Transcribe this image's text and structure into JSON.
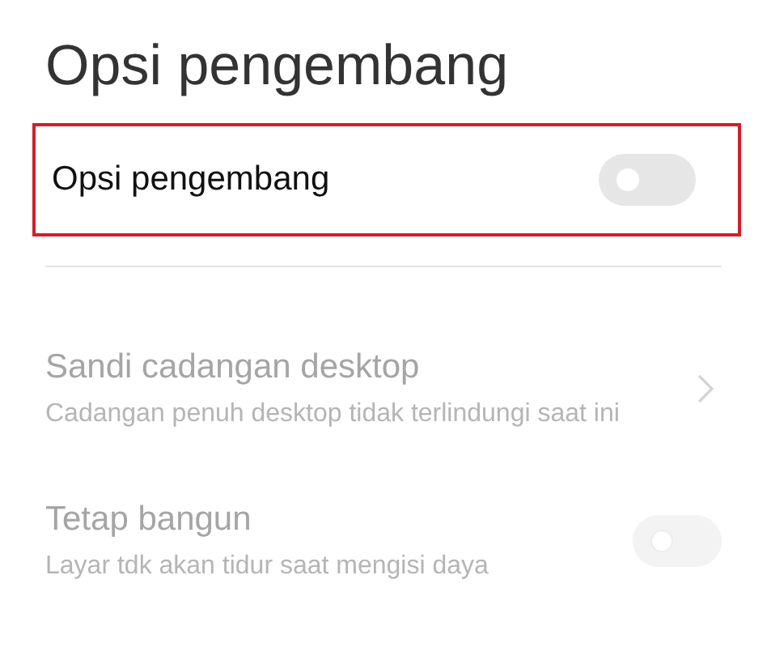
{
  "title": "Opsi pengembang",
  "master": {
    "label": "Opsi pengembang",
    "on": false,
    "highlighted": true
  },
  "items": [
    {
      "kind": "link",
      "title": "Sandi cadangan desktop",
      "subtitle": "Cadangan penuh desktop tidak terlindungi saat ini",
      "disabled": true
    },
    {
      "kind": "toggle",
      "title": "Tetap bangun",
      "subtitle": "Layar tdk akan tidur saat mengisi daya",
      "disabled": true,
      "on": false
    }
  ]
}
